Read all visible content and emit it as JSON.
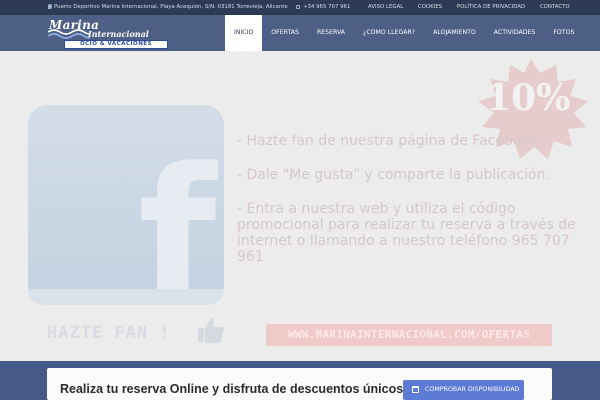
{
  "topbar": {
    "address": "Puerto Deportivo Marina Internacional, Playa Acequión, S/N. 03181 Torrevieja, Alicante",
    "phone": "+34 965 707 961",
    "links": [
      "AVISO LEGAL",
      "COOKIES",
      "POLÍTICA DE PRIVACIDAD",
      "CONTACTO"
    ]
  },
  "logo": {
    "word1": "Marina",
    "word2": "Internacional",
    "tagline": "OCIO & VACACIONES"
  },
  "nav": {
    "items": [
      "INICIO",
      "OFERTAS",
      "RESERVA",
      "¿COMO LLEGAR?",
      "ALOJAMIENTO",
      "ACTIVIDADES",
      "FOTOS"
    ],
    "active": "INICIO"
  },
  "hero": {
    "badge": "10%",
    "bullets": [
      "- Hazte fan de nuestra página de Facebook",
      "- Dale \"Me gusta\" y comparte la publicación.",
      "- Entra a nuestra web y utiliza el código promocional para realizar tu reserva a través de internet o llamando a nuestro teléfono 965 707 961"
    ],
    "fan_text": "HAZTE FAN !",
    "url": "WWW.MARINAINTERNACIONAL.COM/OFERTAS"
  },
  "booking": {
    "title": "Realiza tu reserva Online y disfruta de descuentos únicos",
    "button": "COMPROBAR DISPONIBILIDAD"
  },
  "colors": {
    "topbar": "#2c3a55",
    "header": "#4e5f86",
    "band": "#455a86",
    "button": "#5d7ad4"
  }
}
